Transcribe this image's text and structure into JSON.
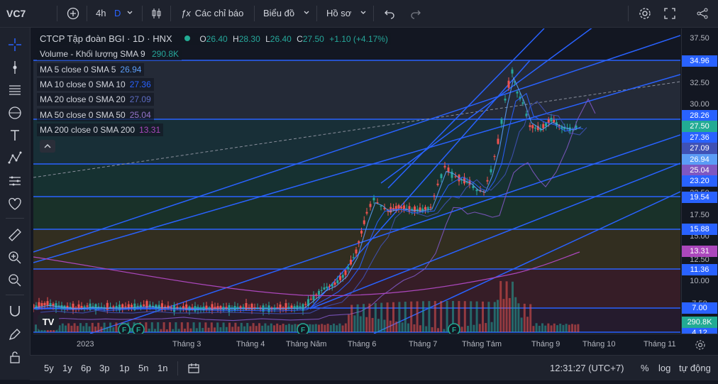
{
  "topbar": {
    "symbol": "VC7",
    "interval": "4h",
    "interval_d": "D",
    "indicators": "Các chỉ báo",
    "chart_type": "Biểu đồ",
    "profile": "Hồ sơ"
  },
  "legend": {
    "title": "CTCP Tập đoàn BGI · 1D · HNX",
    "ohlc": {
      "o_label": "O",
      "o": "26.40",
      "h_label": "H",
      "h": "28.30",
      "l_label": "L",
      "l": "26.40",
      "c_label": "C",
      "c": "27.50",
      "change": "+1.10 (+4.17%)"
    },
    "volume_label": "Volume - Khối lượng SMA 9",
    "volume_value": "290.8K",
    "mas": [
      {
        "label": "MA 5 close 0 SMA 5",
        "value": "26.94",
        "color": "#5b9cf6"
      },
      {
        "label": "MA 10 close 0 SMA 10",
        "value": "27.36",
        "color": "#2962ff"
      },
      {
        "label": "MA 20 close 0 SMA 20",
        "value": "27.09",
        "color": "#3f51b5"
      },
      {
        "label": "MA 50 close 0 SMA 50",
        "value": "25.04",
        "color": "#7e57c2"
      },
      {
        "label": "MA 200 close 0 SMA 200",
        "value": "13.31",
        "color": "#ab47bc"
      }
    ]
  },
  "price_axis": {
    "ticks": [
      "37.50",
      "32.50",
      "30.00",
      "22.50",
      "17.50",
      "15.00",
      "12.50",
      "10.00",
      "7.50"
    ],
    "badges": [
      {
        "label": "34.96",
        "bg": "#2962ff"
      },
      {
        "label": "28.26",
        "bg": "#2962ff"
      },
      {
        "label": "27.50",
        "bg": "#22ab94"
      },
      {
        "label": "27.36",
        "bg": "#2962ff"
      },
      {
        "label": "27.09",
        "bg": "#3f51b5"
      },
      {
        "label": "26.94",
        "bg": "#5b9cf6"
      },
      {
        "label": "25.04",
        "bg": "#7e57c2"
      },
      {
        "label": "23.20",
        "bg": "#2962ff"
      },
      {
        "label": "19.54",
        "bg": "#2962ff"
      },
      {
        "label": "15.88",
        "bg": "#2962ff"
      },
      {
        "label": "13.31",
        "bg": "#ab47bc"
      },
      {
        "label": "11.36",
        "bg": "#2962ff"
      },
      {
        "label": "7.00",
        "bg": "#2962ff"
      },
      {
        "label": "290.8K",
        "bg": "#22ab94"
      },
      {
        "label": "4.12",
        "bg": "#2962ff"
      }
    ]
  },
  "time_axis": [
    "2023",
    "Tháng 3",
    "Tháng 4",
    "Tháng Năm",
    "Tháng 6",
    "Tháng 7",
    "Tháng Tám",
    "Tháng 9",
    "Tháng 10",
    "Tháng 11"
  ],
  "bottombar": {
    "ranges": [
      "5y",
      "1y",
      "6p",
      "3p",
      "1p",
      "5n",
      "1n"
    ],
    "time": "12:31:27 (UTC+7)",
    "percent": "%",
    "log": "log",
    "auto": "tự động"
  },
  "colors": {
    "up": "#26a69a",
    "down": "#ef5350",
    "line": "#2962ff",
    "bg": "#131722"
  }
}
